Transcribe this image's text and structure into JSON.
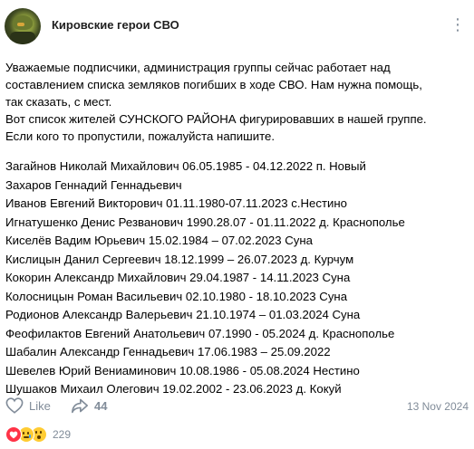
{
  "group": {
    "name": "Кировские герои СВО"
  },
  "post": {
    "intro_lines": [
      "Уважаемые подписчики, администрация группы сейчас работает над",
      "составлением списка земляков погибших в ходе СВО. Нам нужна помощь,",
      "так сказать, с мест.",
      "Вот список жителей СУНСКОГО РАЙОНА фигурировавших в нашей группе.",
      "Если кого то пропустили, пожалуйста напишите."
    ],
    "list": [
      "Загайнов Николай Михайлович 06.05.1985 - 04.12.2022 п. Новый",
      "Захаров Геннадий Геннадьевич",
      "Иванов Евгений Викторович 01.11.1980-07.11.2023 с.Нестино",
      "Игнатушенко Денис Резванович 1990.28.07 - 01.11.2022 д. Краснополье",
      "Киселёв Вадим Юрьевич 15.02.1984 – 07.02.2023 Суна",
      "Кислицын Данил Сергеевич 18.12.1999 – 26.07.2023 д. Курчум",
      "Кокорин Александр Михайлович 29.04.1987 - 14.11.2023 Суна",
      "Колосницын Роман Васильевич 02.10.1980 - 18.10.2023 Суна",
      "Родионов Александр Валерьевич 21.10.1974 – 01.03.2024 Суна",
      "Феофилактов Евгений Анатольевич 07.1990 - 05.2024 д. Краснополье",
      "Шабалин Александр Геннадьевич 17.06.1983 – 25.09.2022",
      "Шевелев Юрий Вениаминович 10.08.1986 - 05.08.2024 Нестино",
      "Шушаков Михаил Олегович 19.02.2002 - 23.06.2023 д. Кокуй"
    ],
    "date": "13 Nov 2024"
  },
  "actions": {
    "like_label": "Like",
    "share_count": "44",
    "reactions_count": "229"
  },
  "colors": {
    "muted": "#818c99",
    "heart": "#ff3347",
    "emoji": "#ffcc33"
  },
  "icons": [
    "avatar",
    "more-icon",
    "heart-outline-icon",
    "share-icon",
    "heart-reaction-icon",
    "cry-reaction-icon",
    "wow-reaction-icon"
  ]
}
